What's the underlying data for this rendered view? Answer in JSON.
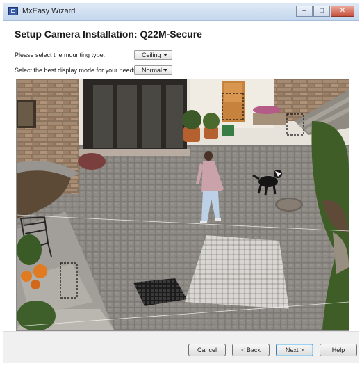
{
  "window": {
    "title": "MxEasy Wizard",
    "controls": {
      "minimize": "–",
      "maximize": "□",
      "close": "✕"
    }
  },
  "wizard": {
    "heading": "Setup Camera Installation: Q22M-Secure",
    "mounting": {
      "label": "Please select the mounting type:",
      "value": "Ceiling"
    },
    "display_mode": {
      "label": "Select the best display mode for your needs:",
      "value": "Normal"
    }
  },
  "preview": {
    "scene": "camera-live-view",
    "colors": {
      "pavement": "#7b7875",
      "wall": "#e7e2d8",
      "stone": "#9a7c63",
      "grass": "#4b6a2e"
    }
  },
  "buttons": {
    "cancel": "Cancel",
    "back": "< Back",
    "next": "Next >",
    "help": "Help"
  },
  "icons": {
    "app": "camera-app-icon",
    "dropdown": "chevron-down-icon"
  }
}
